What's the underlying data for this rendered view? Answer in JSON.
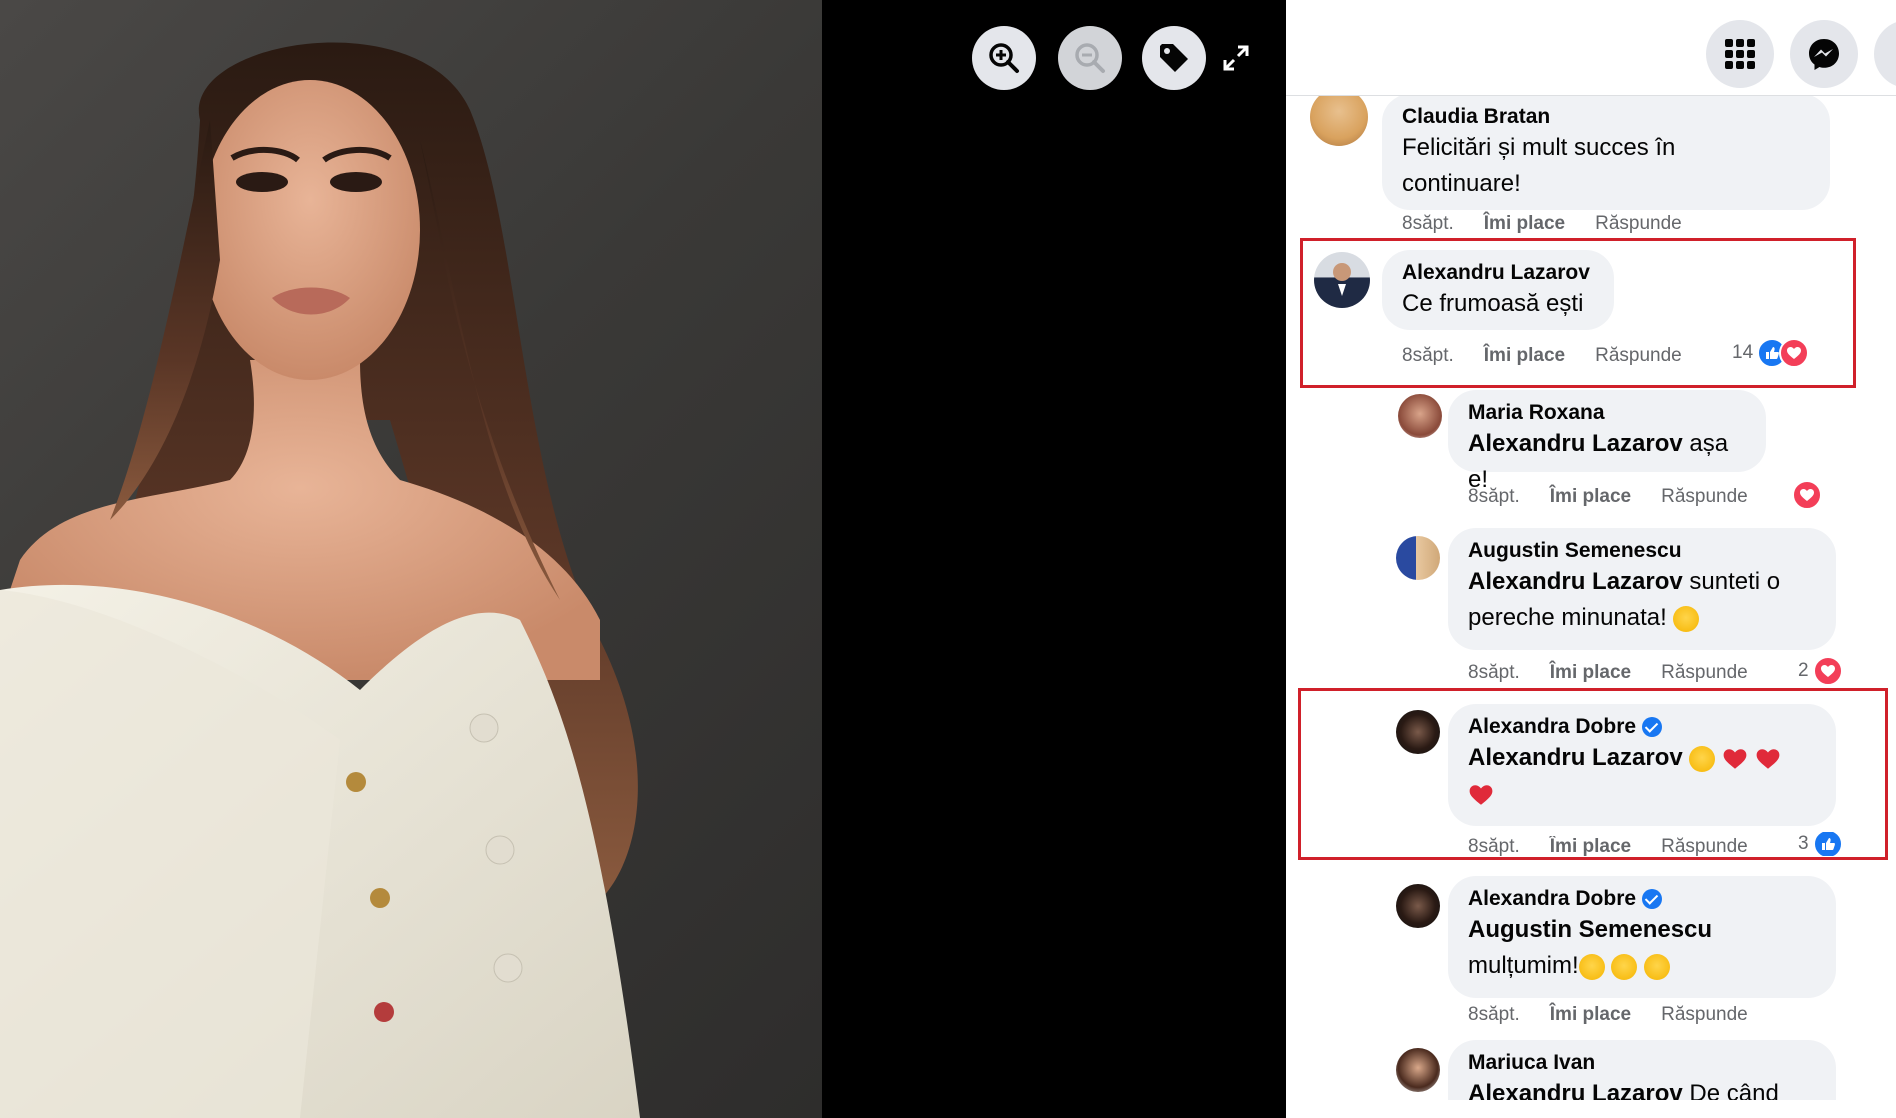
{
  "viewer": {
    "zoom_in_icon": "zoom-in-icon",
    "zoom_out_icon": "zoom-out-icon",
    "tag_icon": "tag-icon",
    "fullscreen_icon": "expand-icon"
  },
  "topbar": {
    "menu_icon": "grid-menu-icon",
    "messenger_icon": "messenger-icon"
  },
  "colors": {
    "highlight": "#d0202a",
    "like": "#1877f2",
    "love": "#f33e58",
    "bubble": "#f0f2f5"
  },
  "comments": [
    {
      "author": "Claudia Bratan",
      "text": "Felicitări și mult succes în continuare!",
      "line1": "Felicitări și mult succes în",
      "line2": "continuare!",
      "time": "8săpt.",
      "like": "Îmi place",
      "reply": "Răspunde"
    },
    {
      "author": "Alexandru Lazarov",
      "text": "Ce frumoasă ești",
      "time": "8săpt.",
      "like": "Îmi place",
      "reply": "Răspunde",
      "reaction_count": "14"
    },
    {
      "author": "Maria Roxana",
      "mention": "Alexandru Lazarov",
      "text": " așa e!",
      "time": "8săpt.",
      "like": "Îmi place",
      "reply": "Răspunde"
    },
    {
      "author": "Augustin Semenescu",
      "mention": "Alexandru Lazarov",
      "text": " sunteti o",
      "text2": "pereche minunata!",
      "time": "8săpt.",
      "like": "Îmi place",
      "reply": "Răspunde",
      "reaction_count": "2"
    },
    {
      "author": "Alexandra Dobre",
      "mention": "Alexandru Lazarov",
      "time": "8săpt.",
      "like": "Îmi place",
      "reply": "Răspunde",
      "reaction_count": "3"
    },
    {
      "author": "Alexandra Dobre",
      "mention": "Augustin Semenescu",
      "text": "mulțumim!",
      "time": "8săpt.",
      "like": "Îmi place",
      "reply": "Răspunde"
    },
    {
      "author": "Mariuca Ivan",
      "mention": "Alexandru Lazarov",
      "text": " De când"
    }
  ]
}
